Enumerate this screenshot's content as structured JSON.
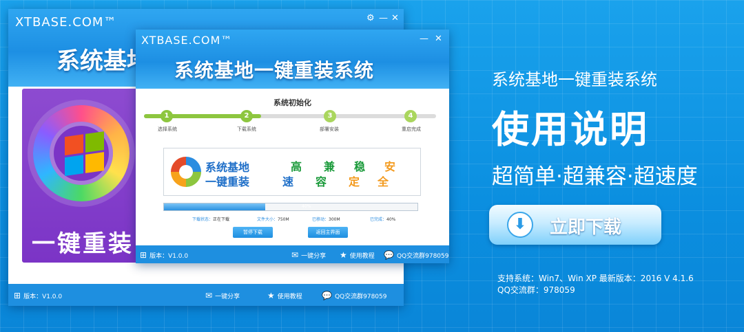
{
  "back_window": {
    "brand": "XTBASE.COM™",
    "title": "系统基地",
    "card_text": "一键重装",
    "statusbar": {
      "version": "版本：V1.0.0",
      "share": "一键分享",
      "tutorial": "使用教程",
      "qq": "QQ交流群978059"
    }
  },
  "front_window": {
    "brand": "XTBASE.COM™",
    "title": "系统基地一键重装系统",
    "section_title": "系统初始化",
    "steps": [
      {
        "num": "1",
        "label": "选择系统"
      },
      {
        "num": "2",
        "label": "下载系统"
      },
      {
        "num": "3",
        "label": "部署安装"
      },
      {
        "num": "4",
        "label": "重启完成"
      }
    ],
    "step_progress": 0.4,
    "banner": {
      "name_line1": "系统基地",
      "name_line2": "一键重装",
      "keywords_row1": [
        "高",
        "兼",
        "稳",
        "安"
      ],
      "keywords_row2": [
        "速",
        "容",
        "定",
        "全"
      ]
    },
    "progress": {
      "value": 0.4,
      "text": "40%"
    },
    "info": {
      "status_key": "下载状态：",
      "status_val": "正在下载",
      "size_key": "文件大小：",
      "size_val": "750M",
      "moved_key": "已移动：",
      "moved_val": "300M",
      "done_key": "已完成：",
      "done_val": "40%"
    },
    "buttons": {
      "pause": "暂停下载",
      "back": "返回主界面"
    },
    "statusbar": {
      "version": "版本：V1.0.0",
      "share": "一键分享",
      "tutorial": "使用教程",
      "qq": "QQ交流群978059"
    }
  },
  "right_panel": {
    "title": "系统基地一键重装系统",
    "headline": "使用说明",
    "subtitle": "超简单·超兼容·超速度",
    "download_button": "立即下载",
    "supported": "支持系统：Win7、Win XP 最新版本：2016 V 4.1.6",
    "qq_group": "QQ交流群：978059"
  },
  "colors": {
    "accent_green": "#8dc63f",
    "keyword_green": "#1a9a3a",
    "keyword_orange": "#f39a1e",
    "brand_blue": "#1d8fe3",
    "card_purple": "#7b34c6",
    "tab_orange": "#f0a10a"
  }
}
